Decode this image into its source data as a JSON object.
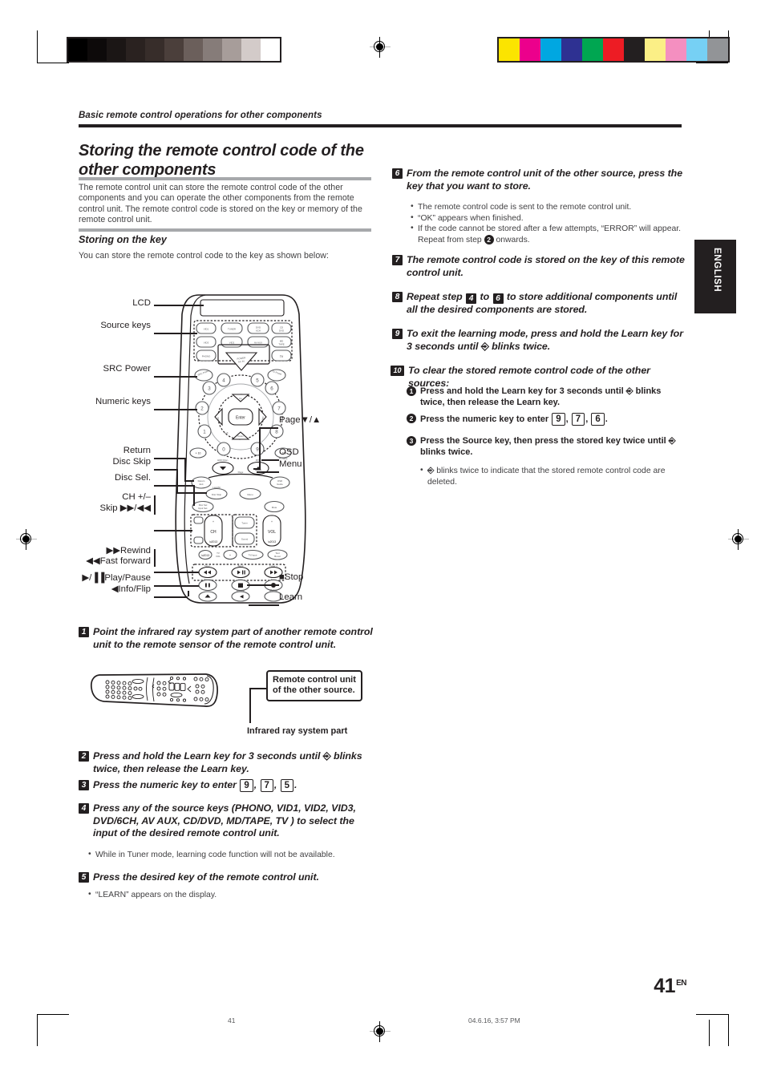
{
  "running_head": "Basic remote control operations for other components",
  "title": "Storing the remote control code of the other components",
  "intro": "The remote control unit can store the remote control code of the other components and you can operate the other components from the remote control unit. The remote control code is stored on the key or memory of the remote control unit.",
  "subsection": {
    "heading": "Storing on the key",
    "note": "You can store the remote control code to the key as shown below:"
  },
  "diagram": {
    "labels_left": [
      {
        "id": "lcd",
        "text": "LCD"
      },
      {
        "id": "source-keys",
        "text": "Source keys"
      },
      {
        "id": "src-power",
        "text": "SRC Power"
      },
      {
        "id": "numeric-keys",
        "text": "Numeric keys"
      },
      {
        "id": "return",
        "text": "Return"
      },
      {
        "id": "disc-skip",
        "text": "Disc Skip"
      },
      {
        "id": "disc-sel",
        "text": "Disc Sel."
      },
      {
        "id": "ch-plus-minus",
        "text": "CH +/–"
      },
      {
        "id": "skip",
        "text": "Skip ▶▶/◀◀"
      },
      {
        "id": "rewind",
        "text": "▶▶Rewind"
      },
      {
        "id": "fast-forward",
        "text": "◀◀Fast forward"
      },
      {
        "id": "play-pause",
        "text": "▶/▐▐Play/Pause"
      },
      {
        "id": "info-flip",
        "text": "◀Info/Flip"
      }
    ],
    "labels_right": [
      {
        "id": "page",
        "text": "Page▼/▲"
      },
      {
        "id": "osd",
        "text": "OSD"
      },
      {
        "id": "menu",
        "text": "Menu"
      },
      {
        "id": "stop",
        "text": "■Stop"
      },
      {
        "id": "learn",
        "text": "Learn"
      }
    ],
    "source_key_caps": [
      "VID1",
      "TUNER",
      "DVD/6CH",
      "CD/DVD",
      "VID3",
      "VID2",
      "AV AUX",
      "MD/TAPE",
      "PHONO",
      "TV"
    ],
    "numeric_caps": [
      "1",
      "2",
      "3",
      "4",
      "5",
      "6",
      "7",
      "8",
      "9",
      "0",
      "+10",
      "+100"
    ],
    "center_cap": "Enter",
    "rocker_caps": [
      "CH",
      "VOL"
    ]
  },
  "figure1": {
    "callout": "Remote control unit of the other source.",
    "caption": "Infrared ray system part"
  },
  "steps": [
    {
      "num": "1",
      "text": "Point the infrared ray system part of another remote control unit to the remote sensor of the remote control unit."
    },
    {
      "num": "2",
      "text_before": "Press and hold the Learn key for 3 seconds until",
      "icon": "\u0001",
      "text_after": "blinks twice, then release the Learn key."
    },
    {
      "num": "3",
      "text_before": "Press the numeric key to enter",
      "keys": [
        "9",
        "7",
        "5"
      ],
      "text_after": "."
    },
    {
      "num": "4",
      "text": "Press any of the source keys (PHONO, VID1, VID2, VID3, DVD/6CH, AV AUX, CD/DVD, MD/TAPE, TV ) to select the input of the desired remote control unit.",
      "bullets": [
        "While in Tuner mode, learning code function will not be available."
      ]
    },
    {
      "num": "5",
      "text": "Press the desired key of the remote control unit.",
      "bullets": [
        "“LEARN” appears on the display."
      ]
    },
    {
      "num": "6",
      "text": "From the remote control unit of the other source, press the key that you want to store.",
      "bullets": [
        "The remote control code is sent to the remote control unit.",
        "“OK” appears when finished.",
        "If the code cannot be stored after a few attempts, “ERROR” will appear. Repeat from step 2 onwards."
      ]
    },
    {
      "num": "7",
      "text": "The remote control code is stored on the key of this remote control unit."
    },
    {
      "num": "8",
      "text_before": "Repeat step",
      "ref_a": "4",
      "text_mid": "to",
      "ref_b": "6",
      "text_after": "to store additional components until all the desired components are stored."
    },
    {
      "num": "9",
      "text_before": "To exit the learning mode, press and hold the Learn key  for 3 seconds until",
      "text_after": "blinks twice."
    },
    {
      "num": "10",
      "text": "To clear the stored remote control code of the other sources:",
      "substeps": [
        {
          "num": "1",
          "text_before": "Press and hold the Learn key for 3 seconds until",
          "text_after": "blinks twice, then release the Learn key."
        },
        {
          "num": "2",
          "text_before": "Press the numeric key to enter",
          "keys": [
            "9",
            "7",
            "6"
          ],
          "text_after": "."
        },
        {
          "num": "3",
          "text_before": "Press the Source key, then press the stored key twice until",
          "text_after": "blinks twice."
        }
      ],
      "bullets": [
        "blinks twice to indicate that the stored remote control code are deleted."
      ]
    }
  ],
  "step6_repeat_note": "onwards.",
  "thumb_tab": "ENGLISH",
  "folio": {
    "number": "41",
    "lang": "EN"
  },
  "footer": {
    "left": "41",
    "right": "04.6.16, 3:57 PM"
  },
  "color_bars": {
    "grayscale": [
      "#000000",
      "#0d0a0a",
      "#1b1615",
      "#2a2220",
      "#372d2a",
      "#4b3f3b",
      "#6b5f5b",
      "#867c79",
      "#a79d9a",
      "#d3cbc9",
      "#ffffff"
    ],
    "process": [
      "#fbe400",
      "#ec008c",
      "#00a7e1",
      "#2e3192",
      "#00a651",
      "#ed1c24",
      "#231f20",
      "#fbef86",
      "#f48fc0",
      "#76d0f4",
      "#929497"
    ]
  }
}
